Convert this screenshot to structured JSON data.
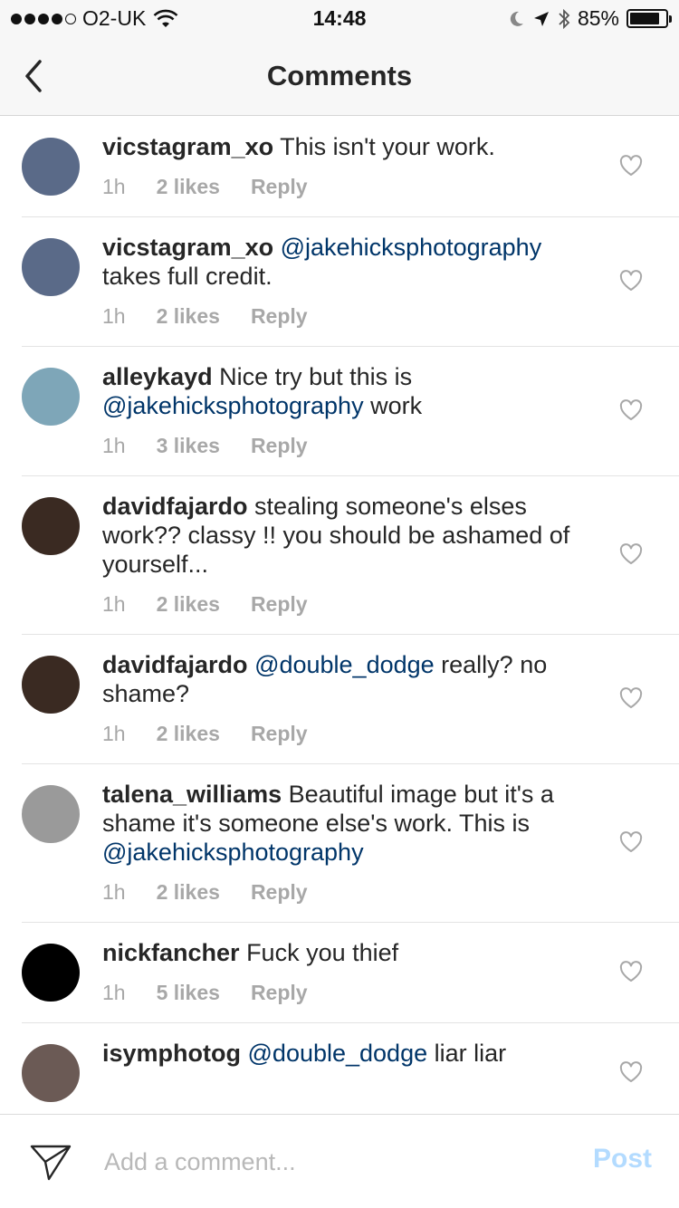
{
  "status_bar": {
    "carrier": "O2-UK",
    "time": "14:48",
    "battery": "85%",
    "battery_level": 0.85,
    "icons": [
      "signal-dots-icon",
      "wifi-icon",
      "moon-icon",
      "location-arrow-icon",
      "bluetooth-icon",
      "battery-icon"
    ]
  },
  "nav": {
    "title": "Comments",
    "back_icon": "chevron-left-icon"
  },
  "comments": [
    {
      "username": "vicstagram_xo",
      "segments": [
        {
          "text": " This isn't your work.",
          "mention": false
        }
      ],
      "time": "1h",
      "likes": "2 likes",
      "reply": "Reply",
      "avatar_color": "#5a6a88"
    },
    {
      "username": "vicstagram_xo",
      "segments": [
        {
          "text": " ",
          "mention": false
        },
        {
          "text": "@jakehicksphotography",
          "mention": true
        },
        {
          "text": " takes full credit.",
          "mention": false
        }
      ],
      "time": "1h",
      "likes": "2 likes",
      "reply": "Reply",
      "avatar_color": "#5a6a88"
    },
    {
      "username": "alleykayd",
      "segments": [
        {
          "text": " Nice try but this is ",
          "mention": false
        },
        {
          "text": "@jakehicksphotography",
          "mention": true
        },
        {
          "text": " work",
          "mention": false
        }
      ],
      "time": "1h",
      "likes": "3 likes",
      "reply": "Reply",
      "avatar_color": "#7ea6b8"
    },
    {
      "username": "davidfajardo",
      "segments": [
        {
          "text": " stealing someone's elses work?? classy !! you should be ashamed of yourself...",
          "mention": false
        }
      ],
      "time": "1h",
      "likes": "2 likes",
      "reply": "Reply",
      "avatar_color": "#3a2a22"
    },
    {
      "username": "davidfajardo",
      "segments": [
        {
          "text": " ",
          "mention": false
        },
        {
          "text": "@double_dodge",
          "mention": true
        },
        {
          "text": " really? no shame?",
          "mention": false
        }
      ],
      "time": "1h",
      "likes": "2 likes",
      "reply": "Reply",
      "avatar_color": "#3a2a22"
    },
    {
      "username": "talena_williams",
      "segments": [
        {
          "text": " Beautiful image but it's a shame it's someone else's work. This is ",
          "mention": false
        },
        {
          "text": "@jakehicksphotography",
          "mention": true
        }
      ],
      "time": "1h",
      "likes": "2 likes",
      "reply": "Reply",
      "avatar_color": "#9a9a9a"
    },
    {
      "username": "nickfancher",
      "segments": [
        {
          "text": " Fuck you thief",
          "mention": false
        }
      ],
      "time": "1h",
      "likes": "5 likes",
      "reply": "Reply",
      "avatar_color": "#000000"
    },
    {
      "username": "isymphotog",
      "segments": [
        {
          "text": " ",
          "mention": false
        },
        {
          "text": "@double_dodge",
          "mention": true
        },
        {
          "text": " liar liar",
          "mention": false
        }
      ],
      "time": "",
      "likes": "",
      "reply": "",
      "avatar_color": "#6b5a55"
    }
  ],
  "input_bar": {
    "placeholder": "Add a comment...",
    "post_label": "Post",
    "send_icon": "paper-plane-icon"
  },
  "colors": {
    "mention": "#003569",
    "meta": "#a8a8a8",
    "post_disabled": "#b3dbff"
  }
}
